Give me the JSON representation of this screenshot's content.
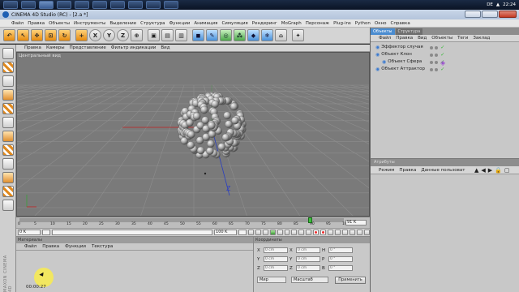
{
  "taskbar": {
    "clock_time": "22:24",
    "language": "DE",
    "buttons": [
      "start",
      "explorer",
      "app",
      "firefox",
      "chrome",
      "folder",
      "media",
      "cinema4d",
      "recorder",
      "app2"
    ]
  },
  "window": {
    "title": "CINEMA 4D Studio (RC) - [2.a *]"
  },
  "menubar": {
    "items": [
      "Файл",
      "Правка",
      "Объекты",
      "Инструменты",
      "Выделение",
      "Структура",
      "Функции",
      "Анимация",
      "Симуляция",
      "Рендеринг",
      "MoGraph",
      "Персонаж",
      "Plug-ins",
      "Python",
      "Окно",
      "Справка"
    ]
  },
  "toolbar": {
    "tools": [
      {
        "icon": "undo-icon",
        "glyph": "↶",
        "style": "or"
      },
      {
        "icon": "select-icon",
        "glyph": "↖",
        "style": "or"
      },
      {
        "icon": "move-icon",
        "glyph": "✥",
        "style": "or"
      },
      {
        "icon": "scale-icon",
        "glyph": "⊡",
        "style": "or"
      },
      {
        "icon": "rotate-icon",
        "glyph": "↻",
        "style": "or"
      },
      {
        "icon": "move-tool-icon",
        "glyph": "+",
        "style": "or"
      },
      {
        "icon": "x-axis-icon",
        "glyph": "X",
        "style": "circ"
      },
      {
        "icon": "y-axis-icon",
        "glyph": "Y",
        "style": "circ"
      },
      {
        "icon": "z-axis-icon",
        "glyph": "Z",
        "style": "circ"
      },
      {
        "icon": "world-coords-icon",
        "glyph": "⊕",
        "style": ""
      },
      {
        "icon": "render-view-icon",
        "glyph": "▣",
        "style": ""
      },
      {
        "icon": "render-picture-icon",
        "glyph": "▤",
        "style": ""
      },
      {
        "icon": "render-settings-icon",
        "glyph": "▥",
        "style": ""
      },
      {
        "icon": "cube-icon",
        "glyph": "◼",
        "style": "bl"
      },
      {
        "icon": "pen-icon",
        "glyph": "✎",
        "style": "bl"
      },
      {
        "icon": "nurbs-icon",
        "glyph": "◎",
        "style": "gr"
      },
      {
        "icon": "array-icon",
        "glyph": "⁂",
        "style": "gr"
      },
      {
        "icon": "deformer-icon",
        "glyph": "◆",
        "style": "bl"
      },
      {
        "icon": "scene-icon",
        "glyph": "❄",
        "style": "bl"
      },
      {
        "icon": "camera-icon",
        "glyph": "⌂",
        "style": ""
      },
      {
        "icon": "light-icon",
        "glyph": "✦",
        "style": ""
      }
    ]
  },
  "left_tools": [
    "polygon-icon",
    "points-icon",
    "edges-icon",
    "polys-icon",
    "texture-icon",
    "axis-icon",
    "tweak-icon",
    "snap-icon",
    "workplane-icon",
    "grid-icon",
    "layer-icon",
    "sculpt-icon"
  ],
  "viewport": {
    "menu": [
      "Правка",
      "Камеры",
      "Представление",
      "Фильтр индикации",
      "Вид"
    ],
    "label": "Центральный вид"
  },
  "timeline": {
    "ticks": [
      "0",
      "5",
      "10",
      "15",
      "20",
      "25",
      "30",
      "35",
      "40",
      "45",
      "50",
      "55",
      "60",
      "65",
      "70",
      "75",
      "80",
      "85",
      "90",
      "95",
      "100"
    ],
    "end_frame": "91 K",
    "current_frame_fraction": 0.89
  },
  "transport": {
    "start_field": "0 K",
    "frame_field": "0 K",
    "end_field": "100 K",
    "end_field2": "100 K"
  },
  "materials": {
    "header": "Материалы",
    "menu": [
      "Файл",
      "Правка",
      "Функции",
      "Текстура"
    ]
  },
  "coordinates": {
    "header": "Координаты",
    "rows": [
      {
        "axis": "X",
        "pos": "0 cm",
        "axis2": "X",
        "size": "0 cm",
        "axis3": "H",
        "rot": "0 °"
      },
      {
        "axis": "Y",
        "pos": "0 cm",
        "axis2": "Y",
        "size": "0 cm",
        "axis3": "P",
        "rot": "0 °"
      },
      {
        "axis": "Z",
        "pos": "0 cm",
        "axis2": "Z",
        "size": "0 cm",
        "axis3": "B",
        "rot": "0 °"
      }
    ],
    "mode_select": "Мир",
    "size_select": "Масштаб",
    "apply_button": "Применить"
  },
  "objects_panel": {
    "tabs": [
      "Объекты",
      "Структура"
    ],
    "menu": [
      "Файл",
      "Правка",
      "Вид",
      "Объекты",
      "Теги",
      "Заклад"
    ],
    "items": [
      {
        "label": "Эффектор случая",
        "indent": 0
      },
      {
        "label": "Объект Клон",
        "indent": 0
      },
      {
        "label": "Объект Сфера",
        "indent": 1
      },
      {
        "label": "Объект Аттрактор",
        "indent": 0
      }
    ]
  },
  "attributes_panel": {
    "header": "Атрибуты",
    "menu": [
      "Режим",
      "Правка",
      "Данные пользоват"
    ]
  },
  "status": {
    "time": "00:00:27",
    "brand": "MAXON CINEMA 4D"
  }
}
